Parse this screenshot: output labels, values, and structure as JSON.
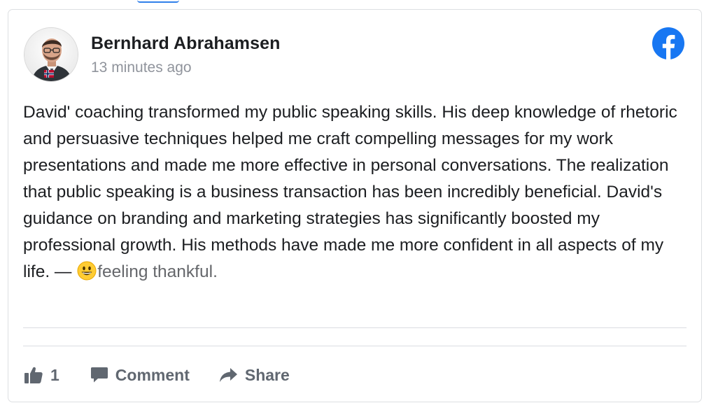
{
  "post": {
    "author_name": "Bernhard Abrahamsen",
    "timestamp": "13 minutes ago",
    "text": "David' coaching transformed my public speaking skills. His deep knowledge of rhetoric and persuasive techniques helped me craft compelling messages for my work presentations and made me more effective in personal conversations. The realization that public speaking is a business transaction has been incredibly beneficial. David's guidance on branding and marketing strategies has significantly boosted my professional growth. His methods have made me more confident in all aspects of my life. —",
    "feeling_text": "feeling thankful.",
    "feeling_emoji": "grinning-face-emoji"
  },
  "source": {
    "icon": "facebook-logo-icon",
    "color": "#1877f2"
  },
  "actions": {
    "like_count": "1",
    "comment_label": "Comment",
    "share_label": "Share"
  },
  "colors": {
    "text": "#1c1e21",
    "muted": "#90949c",
    "action": "#606770",
    "border": "#dddfe2"
  }
}
